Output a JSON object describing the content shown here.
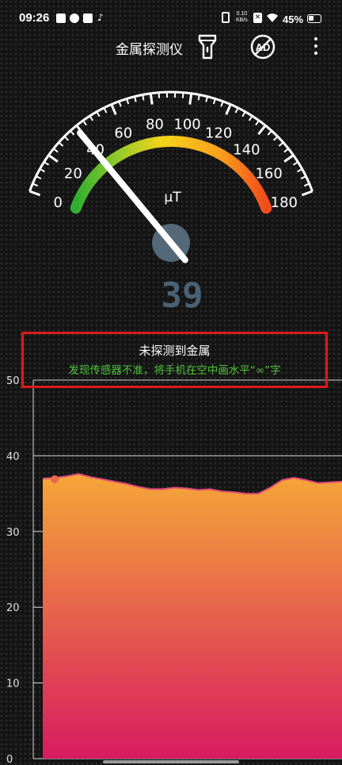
{
  "status_bar": {
    "time": "09:26",
    "net_speed_value": "0.10",
    "net_speed_unit": "KB/s",
    "battery": "45%",
    "battery_level": 0.45,
    "icons": [
      "gallery-icon",
      "app-icon",
      "mail-icon",
      "tiktok-icon",
      "vibrate-icon",
      "x-icon",
      "wifi-icon",
      "battery-icon"
    ]
  },
  "header": {
    "title": "金属探测仪",
    "icons": [
      "flashlight-icon",
      "no-ads-icon",
      "more-vert-icon"
    ],
    "ad_label": "AD"
  },
  "gauge": {
    "unit": "μT",
    "reading": "39",
    "value": 39,
    "min": 0,
    "max": 180,
    "ticks": [
      "0",
      "20",
      "40",
      "60",
      "80",
      "100",
      "120",
      "140",
      "160",
      "180"
    ]
  },
  "status": {
    "main": "未探测到金属",
    "hint": "发现传感器不准，将手机在空中画水平“∞”字"
  },
  "chart_data": {
    "type": "area",
    "title": "",
    "xlabel": "",
    "ylabel": "",
    "ylim": [
      0,
      50
    ],
    "y_ticks": [
      "0",
      "10",
      "20",
      "30",
      "40",
      "50"
    ],
    "grid": true,
    "series": [
      {
        "values": [
          37.0,
          37.1,
          37.3,
          37.6,
          37.2,
          36.9,
          36.6,
          36.3,
          35.9,
          35.6,
          35.6,
          35.8,
          35.7,
          35.5,
          35.6,
          35.3,
          35.2,
          35.0,
          35.0,
          35.8,
          36.8,
          37.1,
          36.8,
          36.4,
          36.5,
          36.6
        ],
        "color_top": "#f5a638",
        "color_bottom": "#d81b60",
        "line_color": "#e04a7a"
      }
    ],
    "marker_value": 36.9,
    "marker_index": 1
  }
}
